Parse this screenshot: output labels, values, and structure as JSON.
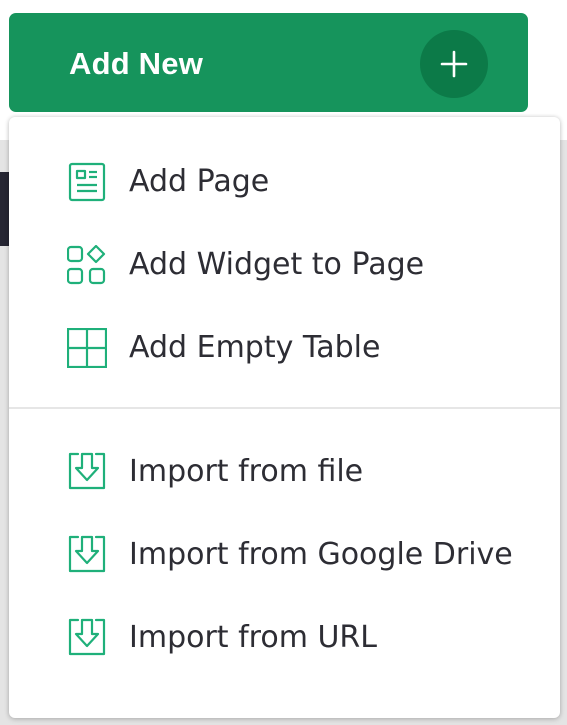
{
  "button": {
    "label": "Add New",
    "icon": "plus-icon"
  },
  "menu": {
    "groups": [
      [
        {
          "label": "Add Page",
          "icon": "page-icon"
        },
        {
          "label": "Add Widget to Page",
          "icon": "widget-icon"
        },
        {
          "label": "Add Empty Table",
          "icon": "table-icon"
        }
      ],
      [
        {
          "label": "Import from file",
          "icon": "import-icon"
        },
        {
          "label": "Import from Google Drive",
          "icon": "import-icon"
        },
        {
          "label": "Import from URL",
          "icon": "import-icon"
        }
      ]
    ]
  },
  "colors": {
    "accent": "#16945c",
    "accent_dark": "#0c7a48",
    "icon": "#1fb07a",
    "text": "#2d2d34"
  }
}
